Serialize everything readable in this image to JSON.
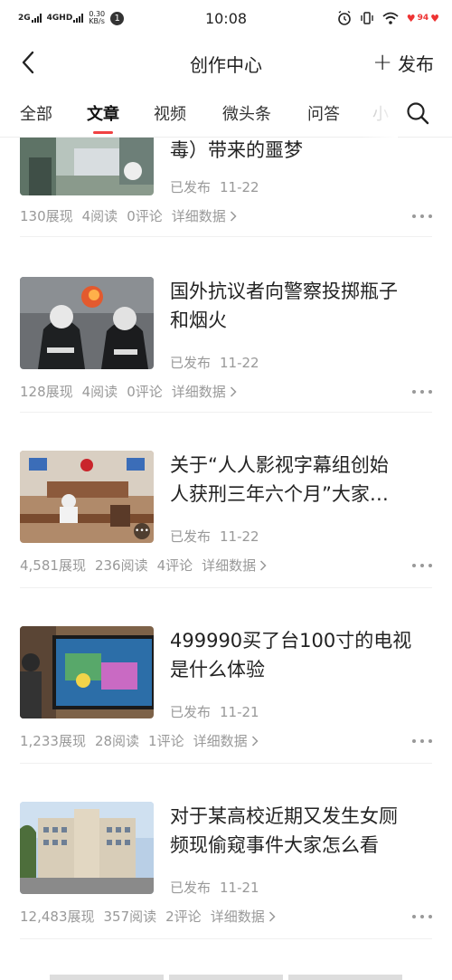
{
  "status_bar": {
    "net1": "2G",
    "net2": "4GHD",
    "speed_value": "0.30",
    "speed_unit": "KB/s",
    "notification_count": "1",
    "time": "10:08",
    "battery_label": "94"
  },
  "nav": {
    "title": "创作中心",
    "publish_label": "发布"
  },
  "tabs": [
    {
      "label": "全部"
    },
    {
      "label": "文章"
    },
    {
      "label": "视频"
    },
    {
      "label": "微头条"
    },
    {
      "label": "问答"
    },
    {
      "label": "小"
    }
  ],
  "articles": [
    {
      "title_lines": [
        "毒）带来的噩梦"
      ],
      "status": "已发布",
      "date": "11-22",
      "impressions": "130展现",
      "reads": "4阅读",
      "comments": "0评论",
      "detail": "详细数据",
      "thumb_icon": "hospital-photo"
    },
    {
      "title_lines": [
        "国外抗议者向警察投掷瓶子",
        "和烟火"
      ],
      "status": "已发布",
      "date": "11-22",
      "impressions": "128展现",
      "reads": "4阅读",
      "comments": "0评论",
      "detail": "详细数据",
      "thumb_icon": "police-photo"
    },
    {
      "title_lines": [
        "关于“人人影视字幕组创始",
        "人获刑三年六个月”大家…"
      ],
      "status": "已发布",
      "date": "11-22",
      "impressions": "4,581展现",
      "reads": "236阅读",
      "comments": "4评论",
      "detail": "详细数据",
      "thumb_icon": "courtroom-photo"
    },
    {
      "title_lines": [
        "499990买了台100寸的电视",
        "是什么体验"
      ],
      "status": "已发布",
      "date": "11-21",
      "impressions": "1,233展现",
      "reads": "28阅读",
      "comments": "1评论",
      "detail": "详细数据",
      "thumb_icon": "tv-photo"
    },
    {
      "title_lines": [
        "对于某高校近期又发生女厕",
        "频现偷窥事件大家怎么看"
      ],
      "status": "已发布",
      "date": "11-21",
      "impressions": "12,483展现",
      "reads": "357阅读",
      "comments": "2评论",
      "detail": "详细数据",
      "thumb_icon": "building-photo"
    }
  ],
  "colors": {
    "accent": "#f04142",
    "muted_text": "#999999",
    "primary_text": "#222222"
  }
}
